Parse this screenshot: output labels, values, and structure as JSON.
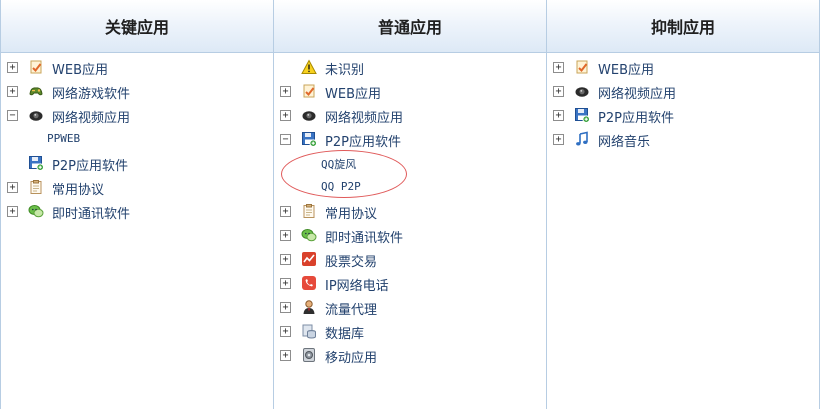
{
  "columns": [
    {
      "header": "关键应用",
      "items": [
        {
          "toggle": "+",
          "icon": "note-check-icon",
          "label": "WEB应用"
        },
        {
          "toggle": "+",
          "icon": "game-icon",
          "label": "网络游戏软件"
        },
        {
          "toggle": "−",
          "icon": "camera-icon",
          "label": "网络视频应用"
        },
        {
          "toggle": "",
          "icon": "",
          "label": "PPWEB",
          "child": true
        },
        {
          "toggle": "",
          "icon": "floppy-icon",
          "label": "P2P应用软件"
        },
        {
          "toggle": "+",
          "icon": "clipboard-icon",
          "label": "常用协议"
        },
        {
          "toggle": "+",
          "icon": "chat-icon",
          "label": "即时通讯软件"
        }
      ]
    },
    {
      "header": "普通应用",
      "items": [
        {
          "toggle": "",
          "icon": "warning-icon",
          "label": "未识别"
        },
        {
          "toggle": "+",
          "icon": "note-check-icon",
          "label": "WEB应用"
        },
        {
          "toggle": "+",
          "icon": "camera-icon",
          "label": "网络视频应用"
        },
        {
          "toggle": "−",
          "icon": "floppy-icon",
          "label": "P2P应用软件"
        },
        {
          "toggle": "",
          "icon": "",
          "label": "QQ旋风",
          "child": true
        },
        {
          "toggle": "",
          "icon": "",
          "label": "QQ P2P",
          "child": true
        },
        {
          "toggle": "+",
          "icon": "clipboard-icon",
          "label": "常用协议"
        },
        {
          "toggle": "+",
          "icon": "chat-icon",
          "label": "即时通讯软件"
        },
        {
          "toggle": "+",
          "icon": "stock-chart-icon",
          "label": "股票交易"
        },
        {
          "toggle": "+",
          "icon": "phone-icon",
          "label": "IP网络电话"
        },
        {
          "toggle": "+",
          "icon": "user-proxy-icon",
          "label": "流量代理"
        },
        {
          "toggle": "+",
          "icon": "database-icon",
          "label": "数据库"
        },
        {
          "toggle": "+",
          "icon": "mobile-icon",
          "label": "移动应用"
        }
      ]
    },
    {
      "header": "抑制应用",
      "items": [
        {
          "toggle": "+",
          "icon": "note-check-icon",
          "label": "WEB应用"
        },
        {
          "toggle": "+",
          "icon": "camera-icon",
          "label": "网络视频应用"
        },
        {
          "toggle": "+",
          "icon": "floppy-icon",
          "label": "P2P应用软件"
        },
        {
          "toggle": "+",
          "icon": "music-note-icon",
          "label": "网络音乐"
        }
      ]
    }
  ]
}
